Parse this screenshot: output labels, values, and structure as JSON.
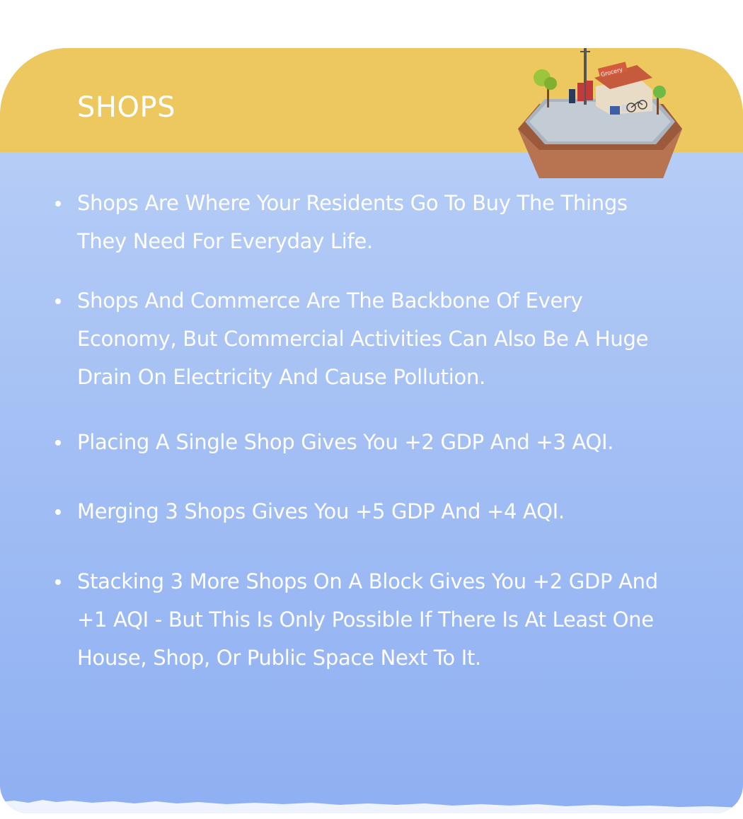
{
  "card": {
    "title": "SHOPS",
    "illustration": {
      "icon": "grocery-shop-icon",
      "sign_text": "Grocery"
    },
    "bullets": [
      "Shops Are Where Your Residents Go To Buy The Things They Need For Everyday Life.",
      "Shops And Commerce Are The Backbone Of Every Economy, But Commercial Activities Can Also Be A Huge Drain On Electricity And Cause Pollution.",
      "Placing A Single Shop Gives You +2 GDP And +3 AQI.",
      "Merging 3 Shops Gives You +5 GDP And +4 AQI.",
      "Stacking 3 More Shops On A Block Gives You +2 GDP And +1 AQI - But This Is Only Possible If There Is At Least One House, Shop, Or Public Space Next To It."
    ]
  },
  "colors": {
    "header": "#ecc85f",
    "body_top": "#bcd1f7",
    "body_bottom": "#8eaff2",
    "text": "#ffffff"
  }
}
